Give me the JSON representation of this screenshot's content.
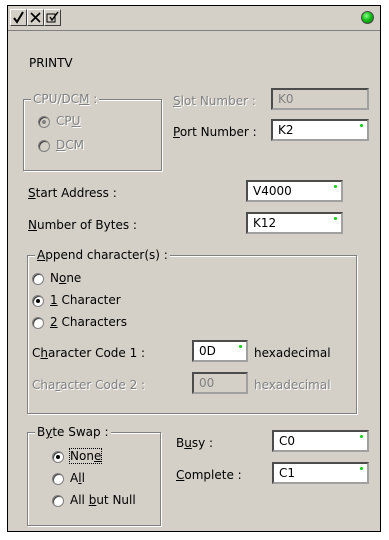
{
  "toolbar": {
    "icons": [
      "check-icon",
      "cancel-x-icon",
      "help-icon"
    ],
    "status_led_color": "#14c014"
  },
  "title": "PRINTV",
  "cpu_dcm": {
    "legend_pre": "CPU/DC",
    "legend_ul": "M",
    "legend_post": " :",
    "cpu_pre": "CP",
    "cpu_ul": "U",
    "dcm_ul": "D",
    "dcm_post": "CM"
  },
  "slot": {
    "label_ul": "S",
    "label_post": "lot Number :",
    "value": "K0"
  },
  "port": {
    "label_ul": "P",
    "label_post": "ort Number :",
    "value": "K2"
  },
  "start_address": {
    "label_ul": "S",
    "label_post": "tart Address :",
    "value": "V4000"
  },
  "num_bytes": {
    "label_ul": "N",
    "label_post": "umber of Bytes :",
    "value": "K12"
  },
  "append": {
    "legend_ul": "A",
    "legend_post": "ppend character(s) :",
    "none_pre": "N",
    "none_ul": "o",
    "none_post": "ne",
    "one_ul": "1",
    "one_post": " Character",
    "two_ul": "2",
    "two_post": " Characters",
    "code1_pre": "C",
    "code1_ul": "h",
    "code1_post": "aracter  Code 1 :",
    "code1_value": "0D",
    "code1_suffix": "hexadecimal",
    "code2_pre": "Cha",
    "code2_ul": "r",
    "code2_post": "acter  Code 2 :",
    "code2_value": "00",
    "code2_suffix": "hexadecimal"
  },
  "byte_swap": {
    "legend_pre": "B",
    "legend_ul": "y",
    "legend_post": "te Swap :",
    "none_pre": "Non",
    "none_ul": "e",
    "none_post": "",
    "all_pre": "A",
    "all_ul": "l",
    "all_post": "l",
    "allbut_pre": "All ",
    "allbut_ul": "b",
    "allbut_post": "ut Null"
  },
  "busy": {
    "label_pre": "B",
    "label_ul": "u",
    "label_post": "sy :",
    "value": "C0"
  },
  "complete": {
    "label_ul": "C",
    "label_post": "omplete :",
    "value": "C1"
  }
}
